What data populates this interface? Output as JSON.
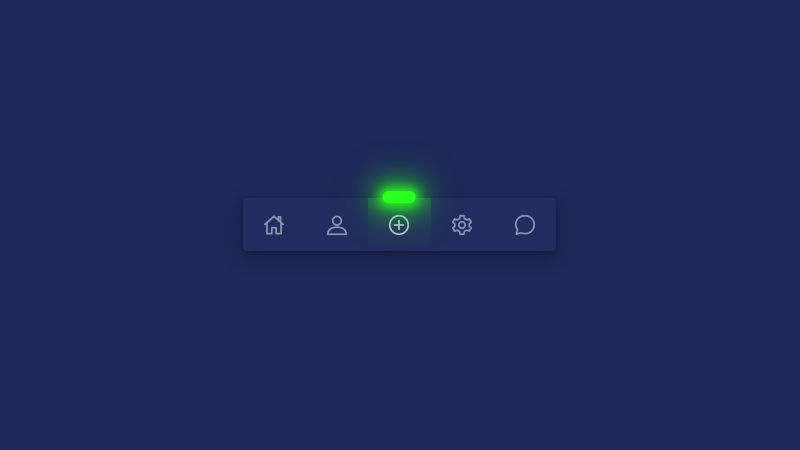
{
  "theme": {
    "background": "#1f295a",
    "navbar_background": "#222c5e",
    "icon_color": "#8d93b3",
    "active_glow_color": "#2bff1f"
  },
  "navbar": {
    "active_item": "add",
    "items": [
      {
        "id": "home",
        "icon": "home-icon"
      },
      {
        "id": "profile",
        "icon": "user-icon"
      },
      {
        "id": "add",
        "icon": "plus-circle-icon"
      },
      {
        "id": "settings",
        "icon": "gear-icon"
      },
      {
        "id": "messages",
        "icon": "chat-bubble-icon"
      }
    ]
  }
}
